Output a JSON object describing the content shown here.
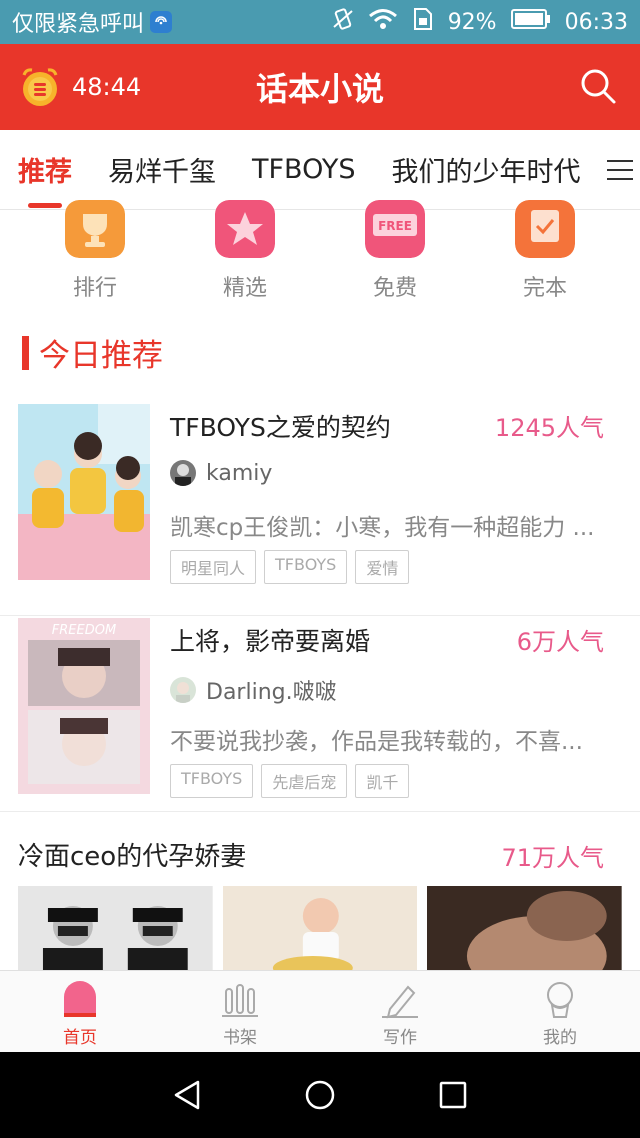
{
  "status_bar": {
    "carrier_text": "仅限紧急呼叫",
    "battery": "92%",
    "time": "06:33"
  },
  "header": {
    "timer": "48:44",
    "title": "话本小说"
  },
  "tabs": [
    {
      "label": "推荐"
    },
    {
      "label": "易烊千玺"
    },
    {
      "label": "TFBOYS"
    },
    {
      "label": "我们的少年时代"
    }
  ],
  "categories": [
    {
      "label": "排行",
      "icon": "trophy-icon",
      "color": "#f59a3a"
    },
    {
      "label": "精选",
      "icon": "star-icon",
      "color": "#f0557a"
    },
    {
      "label": "免费",
      "icon": "free-icon",
      "color": "#f0557a"
    },
    {
      "label": "完本",
      "icon": "check-icon",
      "color": "#f4733a"
    }
  ],
  "section": {
    "title": "今日推荐"
  },
  "books": [
    {
      "title": "TFBOYS之爱的契约",
      "popularity": "1245人气",
      "author": "kamiy",
      "summary": "凯寒cp王俊凯：小寒，我有一种超能力 ...",
      "tags": [
        "明星同人",
        "TFBOYS",
        "爱情"
      ]
    },
    {
      "title": "上将，影帝要离婚",
      "popularity": "6万人气",
      "author": "Darling.啵啵",
      "summary": "不要说我抄袭，作品是我转载的，不喜...",
      "tags": [
        "TFBOYS",
        "先虐后宠",
        "凯千"
      ],
      "cover_text": "FREEDOM"
    }
  ],
  "book3": {
    "title": "冷面ceo的代孕娇妻",
    "popularity": "71万人气"
  },
  "bottom_nav": [
    {
      "label": "首页",
      "icon": "home-icon",
      "active": true
    },
    {
      "label": "书架",
      "icon": "bookshelf-icon",
      "active": false
    },
    {
      "label": "写作",
      "icon": "pencil-icon",
      "active": false
    },
    {
      "label": "我的",
      "icon": "profile-icon",
      "active": false
    }
  ],
  "colors": {
    "brand_red": "#e8362a",
    "popularity_pink": "#e85a8a",
    "status_bar": "#4a9bb0"
  }
}
